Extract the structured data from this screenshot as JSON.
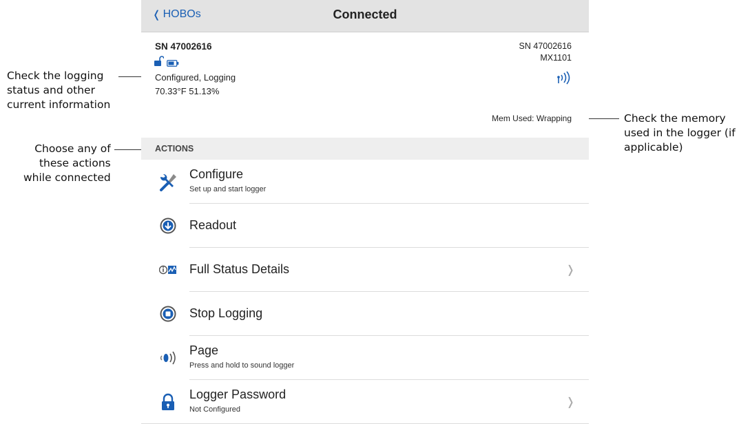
{
  "callouts": {
    "status_info": [
      "Check the logging",
      "status and other",
      "current information"
    ],
    "actions": [
      "Choose any of",
      "these actions",
      "while connected"
    ],
    "memory": [
      "Check the memory",
      "used in the logger (if",
      "applicable)"
    ]
  },
  "navbar": {
    "back_label": "HOBOs",
    "title": "Connected"
  },
  "device": {
    "serial_title": "SN 47002616",
    "status": "Configured, Logging",
    "readings": "70.33°F  51.13%",
    "serial_right": "SN 47002616",
    "model": "MX1101",
    "memory": "Mem Used: Wrapping"
  },
  "actions_header": "ACTIONS",
  "actions": [
    {
      "label": "Configure",
      "sub": "Set up and start logger",
      "icon": "wrench-screwdriver-icon"
    },
    {
      "label": "Readout",
      "sub": "",
      "icon": "download-circle-icon"
    },
    {
      "label": "Full Status Details",
      "sub": "",
      "icon": "status-info-icon"
    },
    {
      "label": "Stop Logging",
      "sub": "",
      "icon": "stop-circle-icon"
    },
    {
      "label": "Page",
      "sub": "Press and hold to sound logger",
      "icon": "speaker-icon"
    },
    {
      "label": "Logger Password",
      "sub": "Not Configured",
      "icon": "lock-icon"
    }
  ],
  "colors": {
    "accent": "#1a5fb4",
    "navbar_bg": "#e3e3e3",
    "section_bg": "#eeeeee"
  }
}
